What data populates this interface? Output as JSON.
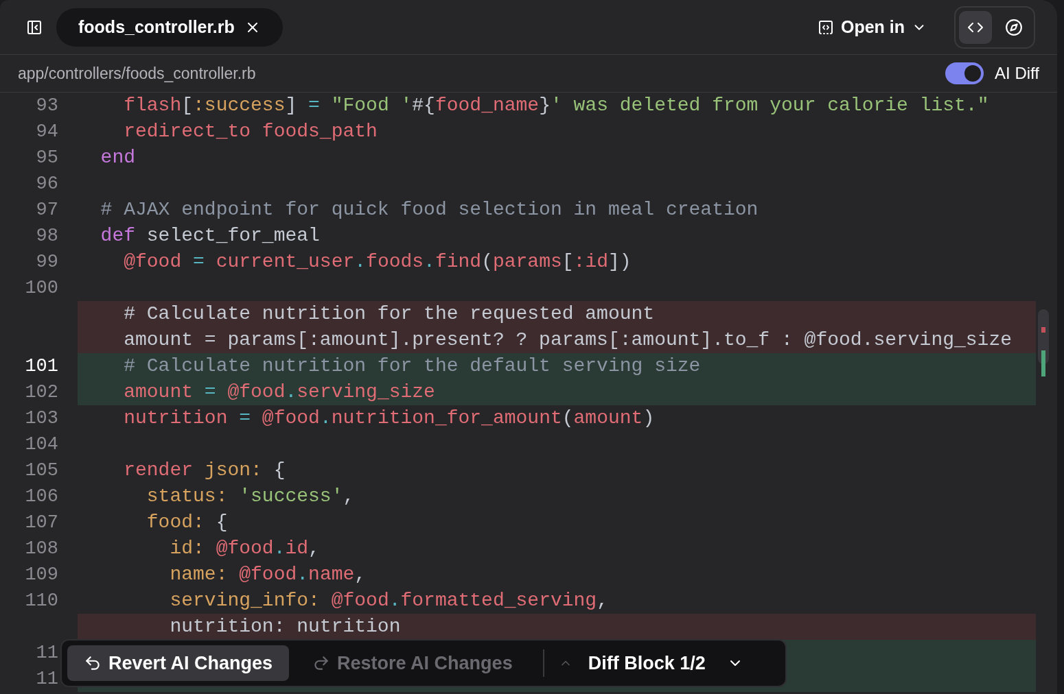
{
  "header": {
    "tab": {
      "label": "foods_controller.rb",
      "selected": true
    },
    "open_in": "Open in",
    "view_modes": [
      {
        "kind": "code",
        "selected": true
      },
      {
        "kind": "preview",
        "selected": false
      }
    ]
  },
  "path_bar": {
    "path": "app/controllers/foods_controller.rb",
    "ai_diff": {
      "label": "AI Diff",
      "on": true
    }
  },
  "lines": [
    {
      "number": "93",
      "kind": "context",
      "current": false,
      "segments": [
        {
          "kind": "name",
          "text": "    flash"
        },
        {
          "kind": "plain",
          "text": "["
        },
        {
          "kind": "symbol",
          "text": ":success"
        },
        {
          "kind": "plain",
          "text": "] "
        },
        {
          "kind": "op",
          "text": "= "
        },
        {
          "kind": "string",
          "text": "\"Food '"
        },
        {
          "kind": "plain",
          "text": "#{"
        },
        {
          "kind": "name",
          "text": "food_name"
        },
        {
          "kind": "plain",
          "text": "}"
        },
        {
          "kind": "string",
          "text": "' was deleted from your calorie list.\""
        }
      ]
    },
    {
      "number": "94",
      "kind": "context",
      "current": false,
      "segments": [
        {
          "kind": "name",
          "text": "    redirect_to foods_path"
        }
      ]
    },
    {
      "number": "95",
      "kind": "context",
      "current": false,
      "segments": [
        {
          "kind": "keyword",
          "text": "  end"
        }
      ]
    },
    {
      "number": "96",
      "kind": "context",
      "current": false
    },
    {
      "number": "97",
      "kind": "context",
      "current": false,
      "segments": [
        {
          "kind": "comment",
          "text": "  # AJAX endpoint for quick food selection in meal creation"
        }
      ]
    },
    {
      "number": "98",
      "kind": "context",
      "current": false,
      "segments": [
        {
          "kind": "keyword",
          "text": "  def"
        },
        {
          "kind": "plain",
          "text": " select_for_meal"
        }
      ]
    },
    {
      "number": "99",
      "kind": "context",
      "current": false,
      "segments": [
        {
          "kind": "name",
          "text": "    @food "
        },
        {
          "kind": "op",
          "text": "= "
        },
        {
          "kind": "name",
          "text": "current_user"
        },
        {
          "kind": "op",
          "text": "."
        },
        {
          "kind": "name",
          "text": "foods"
        },
        {
          "kind": "op",
          "text": "."
        },
        {
          "kind": "name",
          "text": "find"
        },
        {
          "kind": "plain",
          "text": "("
        },
        {
          "kind": "name",
          "text": "params"
        },
        {
          "kind": "plain",
          "text": "["
        },
        {
          "kind": "name",
          "text": ":id"
        },
        {
          "kind": "plain",
          "text": "])"
        }
      ]
    },
    {
      "number": "100",
      "kind": "context",
      "current": false
    },
    {
      "kind": "removed",
      "current": false,
      "segments": [
        {
          "kind": "plain",
          "text": "    # Calculate nutrition for the requested amount"
        }
      ]
    },
    {
      "kind": "removed",
      "current": false,
      "segments": [
        {
          "kind": "plain",
          "text": "    amount = params[:amount].present? ? params[:amount].to_f : @food.serving_size"
        }
      ]
    },
    {
      "number": "101",
      "kind": "added",
      "current": true,
      "segments": [
        {
          "kind": "comment",
          "text": "    # Calculate nutrition for the default serving size"
        }
      ]
    },
    {
      "number": "102",
      "kind": "added",
      "current": false,
      "segments": [
        {
          "kind": "name",
          "text": "    amount "
        },
        {
          "kind": "op",
          "text": "= "
        },
        {
          "kind": "name",
          "text": "@food"
        },
        {
          "kind": "op",
          "text": "."
        },
        {
          "kind": "name",
          "text": "serving_size"
        }
      ]
    },
    {
      "number": "103",
      "kind": "context",
      "current": false,
      "segments": [
        {
          "kind": "name",
          "text": "    nutrition "
        },
        {
          "kind": "op",
          "text": "= "
        },
        {
          "kind": "name",
          "text": "@food"
        },
        {
          "kind": "op",
          "text": "."
        },
        {
          "kind": "name",
          "text": "nutrition_for_amount"
        },
        {
          "kind": "plain",
          "text": "("
        },
        {
          "kind": "name",
          "text": "amount"
        },
        {
          "kind": "plain",
          "text": ")"
        }
      ]
    },
    {
      "number": "104",
      "kind": "context",
      "current": false
    },
    {
      "number": "105",
      "kind": "context",
      "current": false,
      "segments": [
        {
          "kind": "name",
          "text": "    render "
        },
        {
          "kind": "symbol",
          "text": "json:"
        },
        {
          "kind": "plain",
          "text": " {"
        }
      ]
    },
    {
      "number": "106",
      "kind": "context",
      "current": false,
      "segments": [
        {
          "kind": "symbol",
          "text": "      status: "
        },
        {
          "kind": "string",
          "text": "'success'"
        },
        {
          "kind": "plain",
          "text": ","
        }
      ]
    },
    {
      "number": "107",
      "kind": "context",
      "current": false,
      "segments": [
        {
          "kind": "symbol",
          "text": "      food:"
        },
        {
          "kind": "plain",
          "text": " {"
        }
      ]
    },
    {
      "number": "108",
      "kind": "context",
      "current": false,
      "segments": [
        {
          "kind": "symbol",
          "text": "        id: "
        },
        {
          "kind": "name",
          "text": "@food"
        },
        {
          "kind": "op",
          "text": "."
        },
        {
          "kind": "name",
          "text": "id"
        },
        {
          "kind": "plain",
          "text": ","
        }
      ]
    },
    {
      "number": "109",
      "kind": "context",
      "current": false,
      "segments": [
        {
          "kind": "symbol",
          "text": "        name: "
        },
        {
          "kind": "name",
          "text": "@food"
        },
        {
          "kind": "op",
          "text": "."
        },
        {
          "kind": "name",
          "text": "name"
        },
        {
          "kind": "plain",
          "text": ","
        }
      ]
    },
    {
      "number": "110",
      "kind": "context",
      "current": false,
      "segments": [
        {
          "kind": "symbol",
          "text": "        serving_info: "
        },
        {
          "kind": "name",
          "text": "@food"
        },
        {
          "kind": "op",
          "text": "."
        },
        {
          "kind": "name",
          "text": "formatted_serving"
        },
        {
          "kind": "plain",
          "text": ","
        }
      ]
    },
    {
      "kind": "removed",
      "current": false,
      "segments": [
        {
          "kind": "plain",
          "text": "        nutrition: nutrition"
        }
      ]
    },
    {
      "number": "11",
      "kind": "added",
      "current": false
    },
    {
      "number": "11",
      "kind": "added",
      "current": false
    }
  ],
  "diff_toolbar": {
    "revert": {
      "label": "Revert AI Changes",
      "disabled": false
    },
    "restore": {
      "label": "Restore AI Changes",
      "disabled": true
    },
    "prev_disabled": true,
    "next_disabled": false,
    "block": "Diff Block 1/2"
  }
}
